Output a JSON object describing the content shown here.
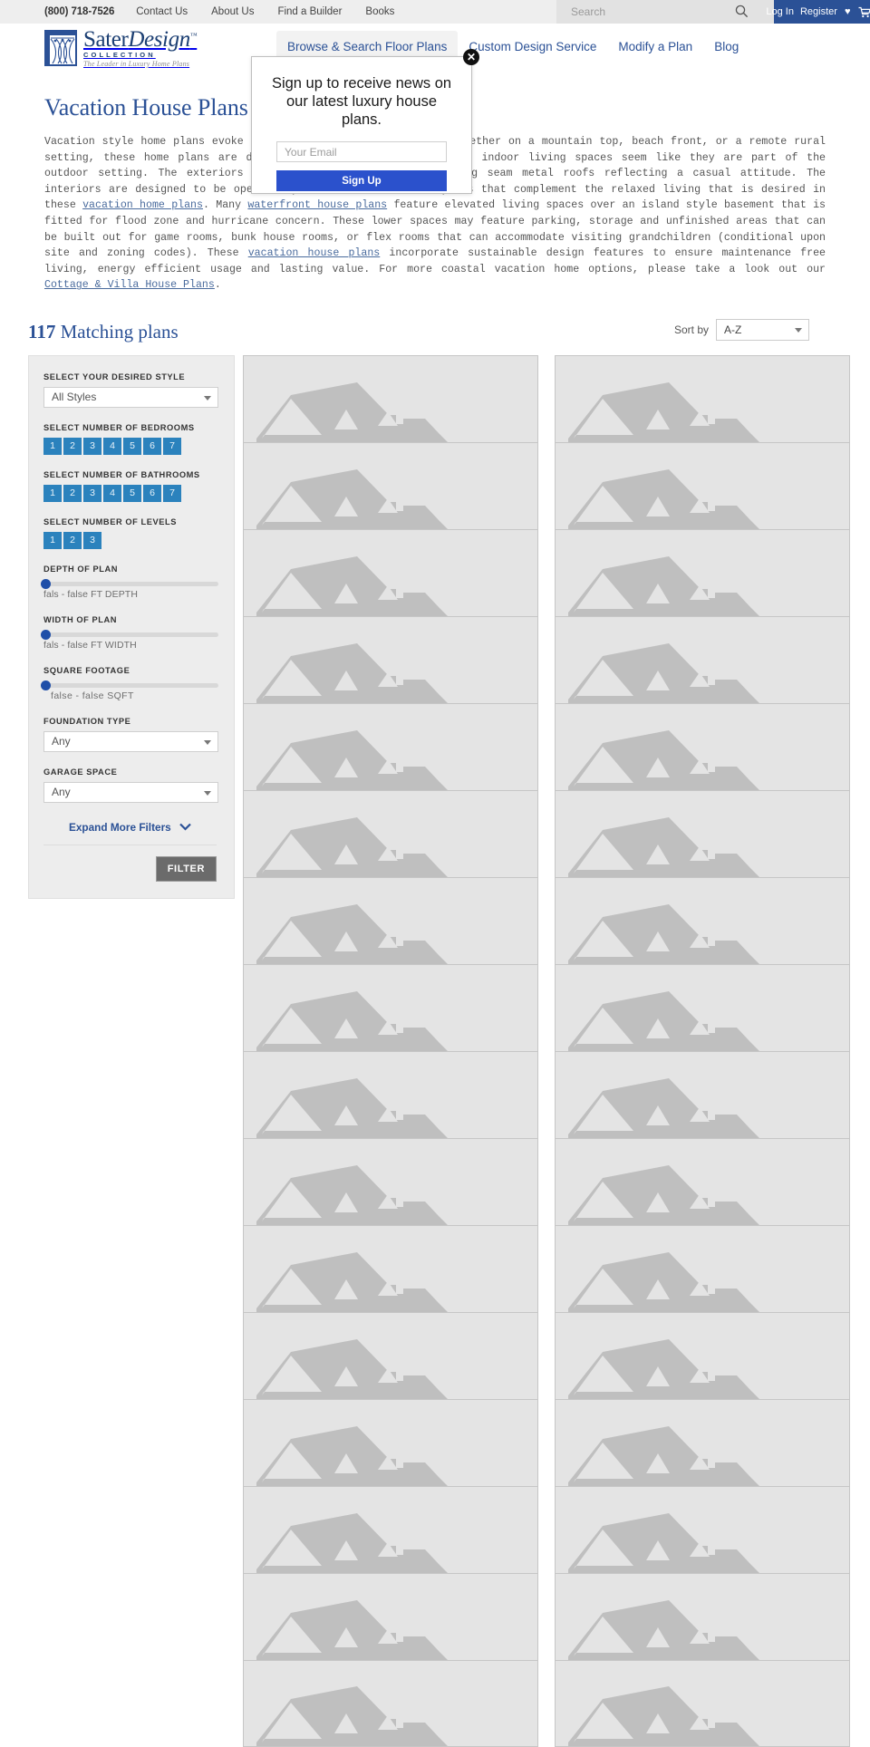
{
  "topbar": {
    "phone": "(800) 718-7526",
    "links": [
      {
        "label": "Contact Us"
      },
      {
        "label": "About Us"
      },
      {
        "label": "Find a Builder"
      },
      {
        "label": "Books"
      }
    ],
    "search_placeholder": "Search",
    "search_value": "",
    "login_label": "Log In",
    "register_label": "Register",
    "cart_count": "0"
  },
  "logo": {
    "name_part1": "Sater",
    "name_part2": "Design",
    "trademark": "™",
    "collection": "COLLECTION",
    "tagline": "The Leader in Luxury Home Plans"
  },
  "nav": {
    "items": [
      {
        "label": "Browse & Search Floor Plans",
        "active": true
      },
      {
        "label": "Custom Design Service",
        "active": false
      },
      {
        "label": "Modify a Plan",
        "active": false
      },
      {
        "label": "Blog",
        "active": false
      }
    ]
  },
  "intro": {
    "title": "Vacation House Plans",
    "paragraph_1": "Vacation style home plans evoke a casual and relaxed lifestyle. Whether on a mountain top, beach front, or a remote rural setting, these home plans are designed to capture views and make indoor living spaces seem like they are part of the outdoor setting. The exteriors may have lap siding with standing seam metal roofs reflecting a casual attitude. The interiors are designed to be open, airy and feature casual layouts that complement the relaxed living that is desired in these ",
    "link_1": "vacation home plans",
    "paragraph_2": ". Many ",
    "link_2": "waterfront house plans",
    "paragraph_3": " feature elevated living spaces over an island style basement that is fitted for flood zone and hurricane concern. These lower spaces may feature parking, storage and unfinished areas that can be built out for game rooms, bunk house rooms, or flex rooms that can accommodate visiting grandchildren (conditional upon site and zoning codes). These ",
    "link_3": "vacation house plans",
    "paragraph_4": " incorporate sustainable design features to ensure maintenance free living, energy efficient usage and lasting value. For more coastal vacation home options, please take a look out our ",
    "link_4": "Cottage & Villa House Plans",
    "paragraph_5": "."
  },
  "results": {
    "count": "117",
    "count_suffix": "Matching plans",
    "sort_label": "Sort by",
    "sort_value": "A-Z",
    "sort_options": [
      "A-Z"
    ]
  },
  "filters": {
    "style_label": "SELECT YOUR DESIRED STYLE",
    "style_value": "All Styles",
    "bedrooms_label": "SELECT NUMBER OF BEDROOMS",
    "bedrooms": [
      "1",
      "2",
      "3",
      "4",
      "5",
      "6",
      "7"
    ],
    "bathrooms_label": "SELECT NUMBER OF BATHROOMS",
    "bathrooms": [
      "1",
      "2",
      "3",
      "4",
      "5",
      "6",
      "7"
    ],
    "levels_label": "SELECT NUMBER OF LEVELS",
    "levels": [
      "1",
      "2",
      "3"
    ],
    "depth_label": "DEPTH OF PLAN",
    "depth_value": "fals - false FT DEPTH",
    "width_label": "WIDTH OF PLAN",
    "width_value": "fals - false FT WIDTH",
    "sqft_label": "SQUARE FOOTAGE",
    "sqft_value": "false  -  false  SQFT",
    "foundation_label": "FOUNDATION TYPE",
    "foundation_value": "Any",
    "garage_label": "GARAGE SPACE",
    "garage_value": "Any",
    "expand_label": "Expand More Filters",
    "expand_chevron": "❯",
    "filter_button": "FILTER"
  },
  "modal": {
    "title": "Sign up to receive news on our latest luxury house plans.",
    "email_placeholder": "Your Email",
    "email_value": "",
    "signup_label": "Sign Up",
    "close_label": "✕"
  },
  "grid": {
    "columns": 2,
    "rows": 16,
    "placeholder_name": "house-placeholder-image"
  },
  "colors": {
    "brand_blue": "#2b5196",
    "accent_blue": "#2b82bd",
    "topbar_bg": "#eeeeee",
    "button_blue": "#2b51cc",
    "card_bg": "#e4e4e4",
    "silhouette": "#bfbfbf"
  }
}
